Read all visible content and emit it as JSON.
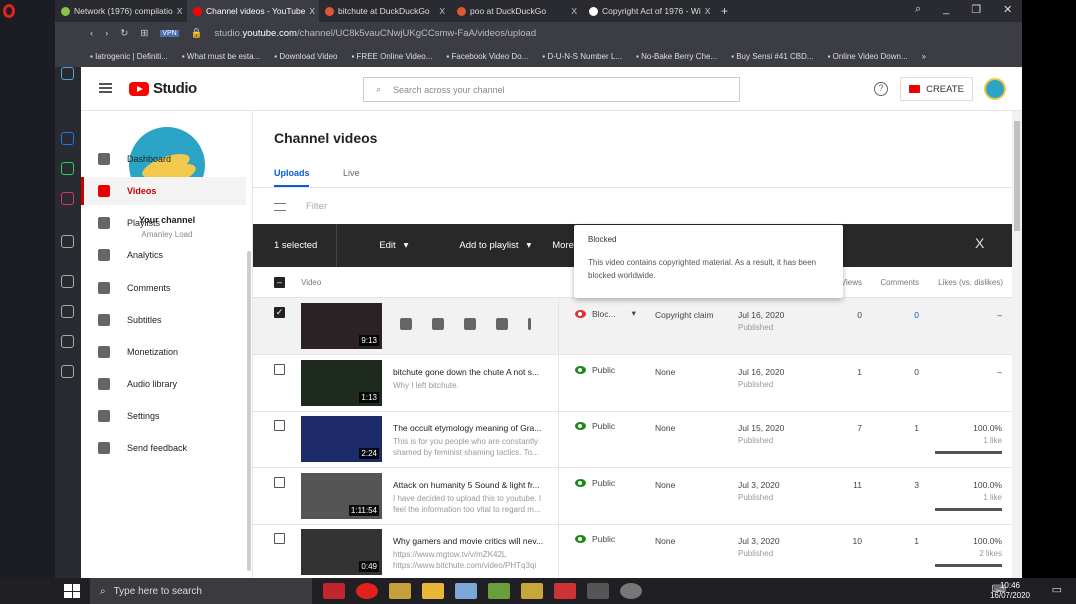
{
  "browser": {
    "tabs": [
      {
        "label": "Network (1976) compilatio",
        "color": "#8bc34a"
      },
      {
        "label": "Channel videos - YouTube",
        "color": "#ff0000",
        "active": true
      },
      {
        "label": "bitchute at DuckDuckGo",
        "color": "#de5833"
      },
      {
        "label": "poo at DuckDuckGo",
        "color": "#de5833"
      },
      {
        "label": "Copyright Act of 1976 - Wi",
        "color": "#ffffff"
      }
    ],
    "tab_close": "X",
    "new_tab": "+",
    "url_prefix": "studio.",
    "url_domain": "youtube.com",
    "url_path": "/channel/UC8k5vauCNwjUKgCCsmw-FaA/videos/upload",
    "vpn": "VPN",
    "bookmarks": [
      "Iatrogenic | Definiti...",
      "What must be esta...",
      "Download Video",
      "FREE Online Video...",
      "Facebook Video Do...",
      "D-U-N-S Number L...",
      "No-Bake Berry Che...",
      "Buy Sensi #41 CBD...",
      "Online Video Down..."
    ],
    "more_bookmarks": "»"
  },
  "header": {
    "logo": "Studio",
    "search_placeholder": "Search across your channel",
    "help": "?",
    "create": "CREATE"
  },
  "sidebar": {
    "channel_label": "Your channel",
    "channel_name": "Amanley Load",
    "items": [
      {
        "label": "Dashboard",
        "icon": "dashboard-icon"
      },
      {
        "label": "Videos",
        "icon": "videos-icon",
        "active": true
      },
      {
        "label": "Playlists",
        "icon": "playlists-icon"
      },
      {
        "label": "Analytics",
        "icon": "analytics-icon"
      },
      {
        "label": "Comments",
        "icon": "comments-icon"
      },
      {
        "label": "Subtitles",
        "icon": "subtitles-icon"
      },
      {
        "label": "Monetization",
        "icon": "dollar-icon"
      },
      {
        "label": "Audio library",
        "icon": "audio-library-icon"
      },
      {
        "label": "Settings",
        "icon": "gear-icon"
      },
      {
        "label": "Send feedback",
        "icon": "feedback-icon"
      }
    ]
  },
  "main": {
    "title": "Channel videos",
    "tabs": [
      "Uploads",
      "Live"
    ],
    "filter_placeholder": "Filter",
    "actions": {
      "selected": "1 selected",
      "edit": "Edit",
      "add_playlist": "Add to playlist",
      "more": "More acti",
      "close": "X"
    },
    "columns": {
      "video": "Video",
      "views": "Views",
      "comments": "Comments",
      "likes": "Likes (vs. dislikes)"
    },
    "tooltip": {
      "title": "Blocked",
      "body": "This video contains copyrighted material. As a result, it has been blocked worldwide."
    },
    "rows": [
      {
        "title": "",
        "desc": "",
        "duration": "9:13",
        "visibility": "Bloc...",
        "restrictions": "Copyright claim",
        "date": "Jul 16, 2020",
        "status": "Published",
        "views": "0",
        "comments": "0",
        "likes": "–",
        "likes_sub": "",
        "like_pct": null,
        "checked": true,
        "blocked": true
      },
      {
        "title": "bitchute gone down the chute A not s...",
        "desc": "Why I left bitchute.",
        "duration": "1:13",
        "visibility": "Public",
        "restrictions": "None",
        "date": "Jul 16, 2020",
        "status": "Published",
        "views": "1",
        "comments": "0",
        "likes": "–",
        "likes_sub": "",
        "like_pct": null
      },
      {
        "title": "The occult etymology meaning of Gra...",
        "desc": "This is for you people who are constantly shamed by feminist shaming tactics. To...",
        "duration": "2:24",
        "visibility": "Public",
        "restrictions": "None",
        "date": "Jul 15, 2020",
        "status": "Published",
        "views": "7",
        "comments": "1",
        "likes": "100.0%",
        "likes_sub": "1 like",
        "like_pct": 100
      },
      {
        "title": "Attack on humanity 5 Sound & light fr...",
        "desc": "I have decided to upload this to youtube. I feel the information too vital to regard m...",
        "duration": "1:11:54",
        "visibility": "Public",
        "restrictions": "None",
        "date": "Jul 3, 2020",
        "status": "Published",
        "views": "11",
        "comments": "3",
        "likes": "100.0%",
        "likes_sub": "1 like",
        "like_pct": 100
      },
      {
        "title": "Why gamers and movie critics will nev...",
        "desc": "https://www.mgtow.tv/v/mZK42L https://www.bitchute.com/video/PHTq3qi",
        "duration": "0:49",
        "visibility": "Public",
        "restrictions": "None",
        "date": "Jul 3, 2020",
        "status": "Published",
        "views": "10",
        "comments": "1",
        "likes": "100.0%",
        "likes_sub": "2 likes",
        "like_pct": 100
      }
    ]
  },
  "taskbar": {
    "search_placeholder": "Type here to search",
    "time": "10:46",
    "date": "16/07/2020"
  },
  "colors": {
    "accent": "#065fd4",
    "youtube_red": "#ff0000",
    "public_green": "#1a8a1a",
    "blocked_red": "#d33333"
  }
}
